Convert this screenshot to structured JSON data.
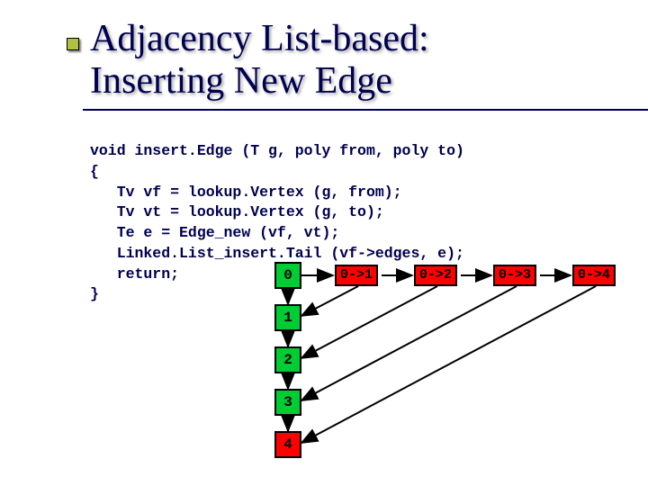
{
  "slide": {
    "title": "Adjacency List-based:\nInserting New Edge"
  },
  "code": {
    "line1": "void insert.Edge (T g, poly from, poly to)",
    "line2": "{",
    "line3": "   Tv vf = lookup.Vertex (g, from);",
    "line4": "   Tv vt = lookup.Vertex (g, to);",
    "line5": "   Te e = Edge_new (vf, vt);",
    "line6": "   Linked.List_insert.Tail (vf->edges, e);",
    "line7": "   return;",
    "line8": "}"
  },
  "vertices": [
    "0",
    "1",
    "2",
    "3",
    "4"
  ],
  "edges": [
    "0->1",
    "0->2",
    "0->3",
    "0->4"
  ]
}
